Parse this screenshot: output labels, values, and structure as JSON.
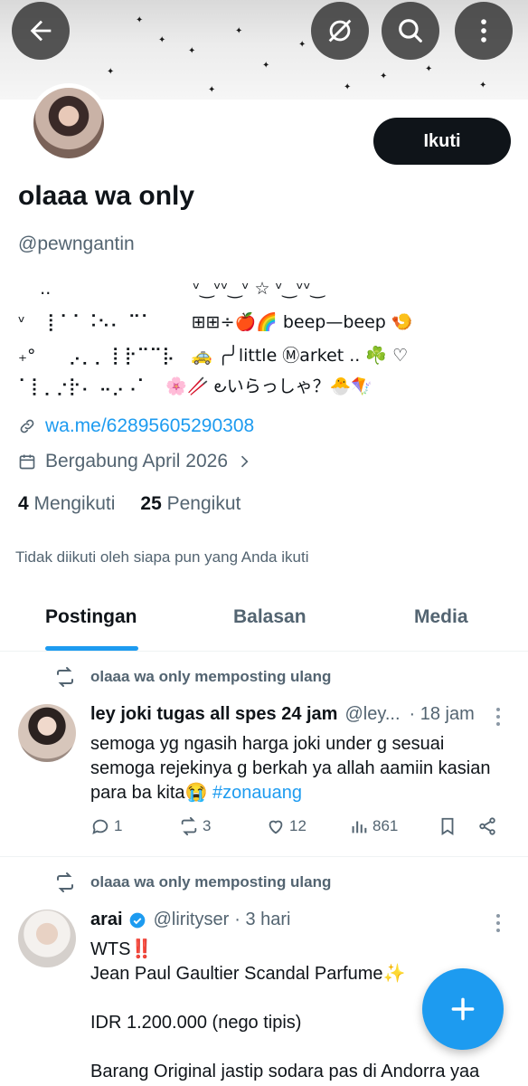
{
  "profile": {
    "display_name": "olaaa wa only",
    "handle": "@pewngantin",
    "follow_label": "Ikuti",
    "bio_lines": [
      "    ..                          ᵛ‿ᵛᵛ‿ᵛ ☆ ᵛ‿ᵛᵛ‿",
      "ᵛ    ⡇⠁⠁⠨⠢⠄ ⠉⠁       ⊞⊞÷🍎🌈 beep—beep 🍤",
      "₊°      ⡠⡀⡀ ⡇⡗⠉⠉⡧   🚕 ╭╯little Ⓜarket .. ☘️ ♡",
      "⠁⡇⡀⡐⡗⠄ ⠤⡠⠠⠁   🌸🥢 ౿いらっしゃ？🐣🪁"
    ],
    "link": "wa.me/62895605290308",
    "joined": "Bergabung April 2026",
    "following_count": "4",
    "following_label": "Mengikuti",
    "followers_count": "25",
    "followers_label": "Pengikut",
    "not_followed_text": "Tidak diikuti oleh siapa pun yang Anda ikuti"
  },
  "tabs": [
    {
      "label": "Postingan",
      "active": true
    },
    {
      "label": "Balasan",
      "active": false
    },
    {
      "label": "Media",
      "active": false
    }
  ],
  "posts": [
    {
      "repost_text": "olaaa wa only memposting ulang",
      "author_name": "ley joki tugas all spes 24 jam",
      "author_handle": "@ley...",
      "time": "· 18 jam",
      "text_lines": [
        "semoga yg ngasih harga joki under g sesuai",
        "semoga rejekinya g berkah ya allah aamiin kasian",
        "para ba kita😭"
      ],
      "hashtag": "#zonauang",
      "replies": "1",
      "reposts": "3",
      "likes": "12",
      "views": "861"
    },
    {
      "repost_text": "olaaa wa only memposting ulang",
      "author_name": "arai",
      "author_handle": "@lirityser",
      "time": "· 3 hari",
      "text_lines": [
        "WTS‼️",
        "Jean Paul Gaultier Scandal Parfume✨",
        "",
        "IDR 1.200.000 (nego tipis)",
        "",
        "Barang Original jastip sodara pas di Andorra yaa"
      ]
    }
  ],
  "colors": {
    "accent": "#1d9bf0",
    "text": "#0f1419",
    "muted": "#536471",
    "follow_bg": "#0f1419"
  },
  "icons": {
    "back": "arrow-left-icon",
    "grok": "grok-icon",
    "search": "search-icon",
    "more": "more-vertical-icon",
    "link": "link-icon",
    "calendar": "calendar-icon",
    "repost": "repost-icon",
    "reply": "reply-icon",
    "like": "heart-icon",
    "views": "views-icon",
    "bookmark": "bookmark-icon",
    "share": "share-icon",
    "compose": "plus-icon"
  }
}
